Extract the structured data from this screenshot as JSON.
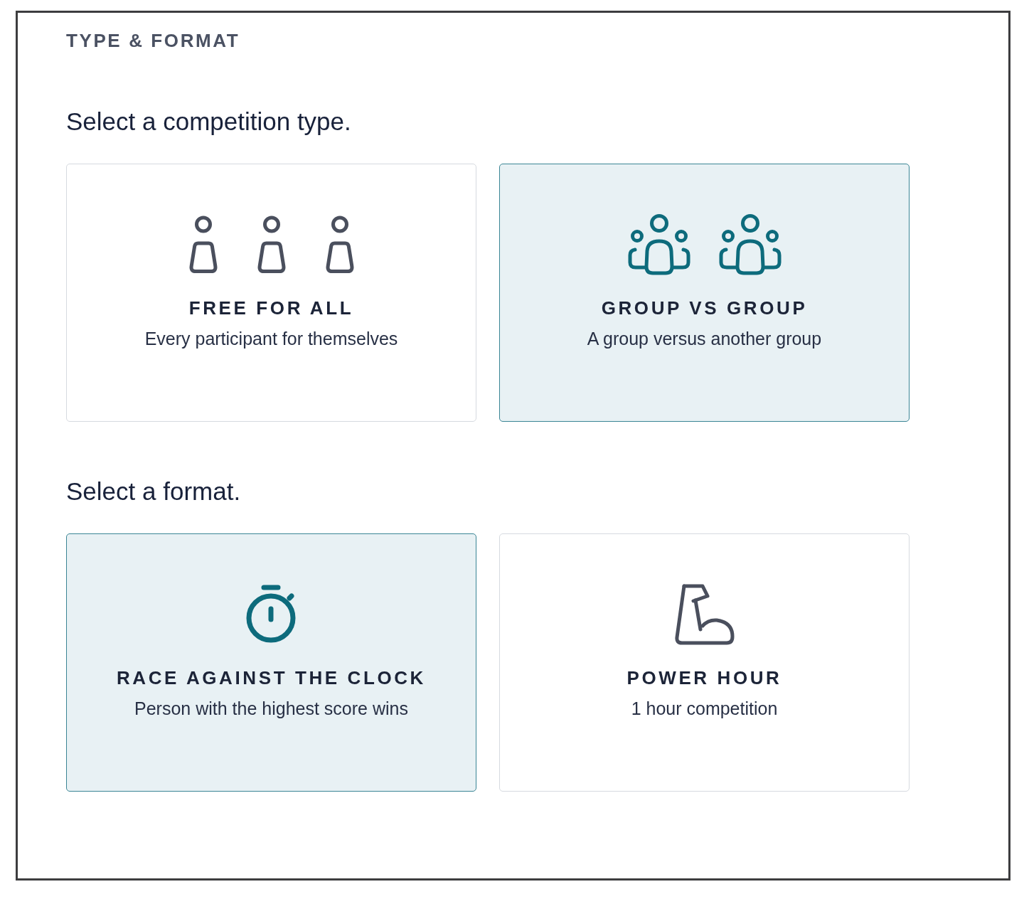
{
  "section": {
    "title": "TYPE & FORMAT"
  },
  "groups": [
    {
      "prompt": "Select a competition type.",
      "options": [
        {
          "kind": "solo",
          "title": "FREE FOR ALL",
          "description": "Every participant for themselves",
          "selected": false
        },
        {
          "kind": "team",
          "title": "GROUP VS GROUP",
          "description": "A group versus another group",
          "selected": true
        }
      ]
    },
    {
      "prompt": "Select a format.",
      "options": [
        {
          "kind": "timer",
          "title": "RACE AGAINST THE CLOCK",
          "description": "Person with the highest score wins",
          "selected": true
        },
        {
          "kind": "strength",
          "title": "POWER HOUR",
          "description": "1 hour competition",
          "selected": false
        }
      ]
    }
  ]
}
